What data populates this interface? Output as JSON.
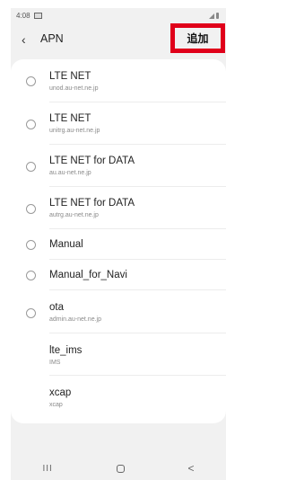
{
  "status": {
    "time": "4:08"
  },
  "header": {
    "back": "‹",
    "title": "APN",
    "add_label": "追加"
  },
  "apns": [
    {
      "name": "LTE NET",
      "sub": "unod.au-net.ne.jp",
      "radio": true
    },
    {
      "name": "LTE NET",
      "sub": "unitrg.au-net.ne.jp",
      "radio": true
    },
    {
      "name": "LTE NET for DATA",
      "sub": "au.au-net.ne.jp",
      "radio": true
    },
    {
      "name": "LTE NET for DATA",
      "sub": "autrg.au-net.ne.jp",
      "radio": true
    },
    {
      "name": "Manual",
      "sub": "",
      "radio": true
    },
    {
      "name": "Manual_for_Navi",
      "sub": "",
      "radio": true
    },
    {
      "name": "ota",
      "sub": "admin.au-net.ne.jp",
      "radio": true
    },
    {
      "name": "lte_ims",
      "sub": "IMS",
      "radio": false
    },
    {
      "name": "xcap",
      "sub": "xcap",
      "radio": false
    }
  ],
  "nav": {
    "recent": "III",
    "back": "<"
  }
}
